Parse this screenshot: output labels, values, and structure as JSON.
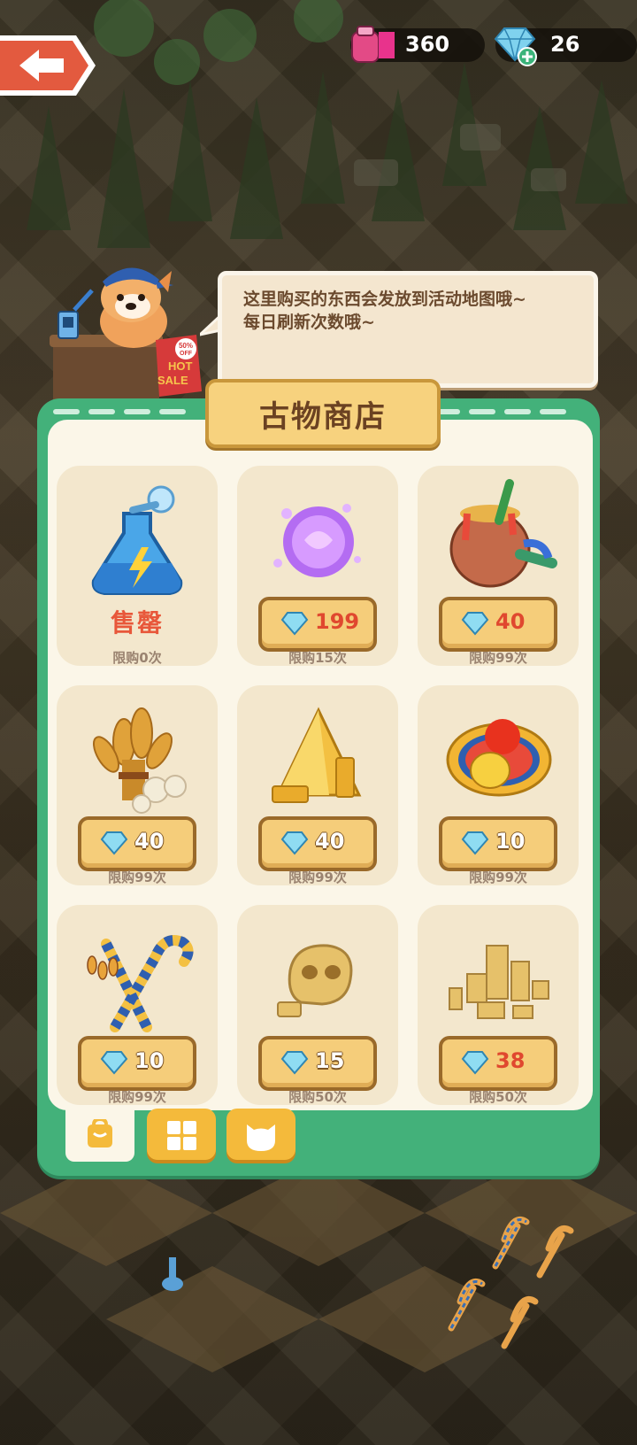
{
  "top_bar": {
    "back_icon": "back-arrow-icon",
    "ink": {
      "icon": "ink-bottle-icon",
      "value": "360"
    },
    "gems": {
      "icon": "gem-plus-icon",
      "value": "26"
    }
  },
  "npc": {
    "sign_percent": "50%",
    "sign_off": "OFF",
    "sign_hot": "HOT",
    "sign_sale": "SALE",
    "speech_line1": "这里购买的东西会发放到活动地图哦~",
    "speech_line2": "每日刷新次数哦~"
  },
  "shop": {
    "title": "古物商店",
    "items": [
      {
        "icon": "lightning-potion-icon",
        "price": "",
        "status": "售罄",
        "limit": "限购0次"
      },
      {
        "icon": "crystal-orb-icon",
        "price": "199",
        "limit": "限购15次",
        "price_color": "red"
      },
      {
        "icon": "paint-pot-icon",
        "price": "40",
        "limit": "限购99次",
        "price_color": "red"
      },
      {
        "icon": "wheat-bundle-icon",
        "price": "40",
        "limit": "限购99次",
        "price_color": "white"
      },
      {
        "icon": "gold-pyramid-icon",
        "price": "40",
        "limit": "限购99次",
        "price_color": "white"
      },
      {
        "icon": "scarab-amulet-icon",
        "price": "10",
        "limit": "限购99次",
        "price_color": "white"
      },
      {
        "icon": "crook-flail-icon",
        "price": "10",
        "limit": "限购99次",
        "price_color": "white"
      },
      {
        "icon": "sand-skull-icon",
        "price": "15",
        "limit": "限购50次",
        "price_color": "white"
      },
      {
        "icon": "sand-ruins-icon",
        "price": "38",
        "limit": "限购50次",
        "price_color": "red"
      }
    ]
  },
  "tabs": [
    {
      "icon": "bag-icon",
      "active": true
    },
    {
      "icon": "grid-icon",
      "active": false
    },
    {
      "icon": "cat-face-icon",
      "active": false
    }
  ],
  "colors": {
    "panel_green": "#43b17a",
    "card_bg": "#f3e7cd",
    "price_btn": "#f5cd7a",
    "sold_out_red": "#e8573a",
    "tab_orange": "#f4ba3b"
  }
}
